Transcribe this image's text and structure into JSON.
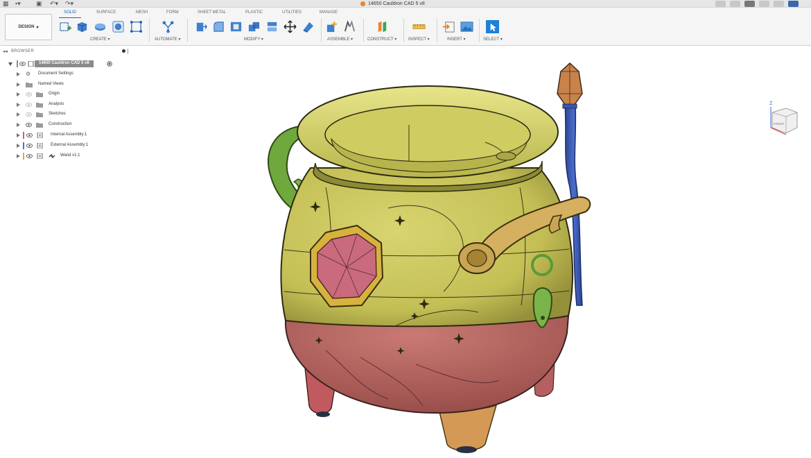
{
  "window": {
    "document_title": "14650 Cauldron CAD 5 v8"
  },
  "workspace": {
    "label": "DESIGN"
  },
  "tabs": [
    {
      "label": "SOLID",
      "active": true
    },
    {
      "label": "SURFACE",
      "active": false
    },
    {
      "label": "MESH",
      "active": false
    },
    {
      "label": "FORM",
      "active": false
    },
    {
      "label": "SHEET METAL",
      "active": false
    },
    {
      "label": "PLASTIC",
      "active": false
    },
    {
      "label": "UTILITIES",
      "active": false
    },
    {
      "label": "MANAGE",
      "active": false
    }
  ],
  "groups": {
    "create": "CREATE ▾",
    "automate": "AUTOMATE ▾",
    "modify": "MODIFY ▾",
    "assemble": "ASSEMBLE ▾",
    "construct": "CONSTRUCT ▾",
    "inspect": "INSPECT ▾",
    "insert": "INSERT ▾",
    "select": "SELECT ▾"
  },
  "browser": {
    "title": "BROWSER",
    "root": "14650 Cauldron CAD 5 v8",
    "items": [
      {
        "label": "Document Settings",
        "icon": "gear-icon"
      },
      {
        "label": "Named Views",
        "icon": "folder-icon"
      },
      {
        "label": "Origin",
        "icon": "folder-icon"
      },
      {
        "label": "Analysis",
        "icon": "folder-icon"
      },
      {
        "label": "Sketches",
        "icon": "folder-icon"
      },
      {
        "label": "Construction",
        "icon": "folder-icon"
      },
      {
        "label": "Internal Assembly:1",
        "icon": "component-icon",
        "color": "#d94f9c"
      },
      {
        "label": "External Assembly:1",
        "icon": "component-icon",
        "color": "#3d7cc9"
      },
      {
        "label": "Wand v1:1",
        "icon": "link-icon",
        "color": "#e8a33a"
      }
    ]
  },
  "viewcube": {
    "face": "FRONT",
    "axis": "Z"
  },
  "colors": {
    "accent": "#1f5fb4",
    "cauldron_body": "#c9c45a",
    "cauldron_rim": "#dcdc6e",
    "cauldron_base": "#b86a66",
    "gem": "#c96a7d",
    "left_handle": "#6fa83c",
    "wand_shaft": "#3a57a8",
    "wand_tip": "#c9824a",
    "feet": "#d49a55"
  }
}
